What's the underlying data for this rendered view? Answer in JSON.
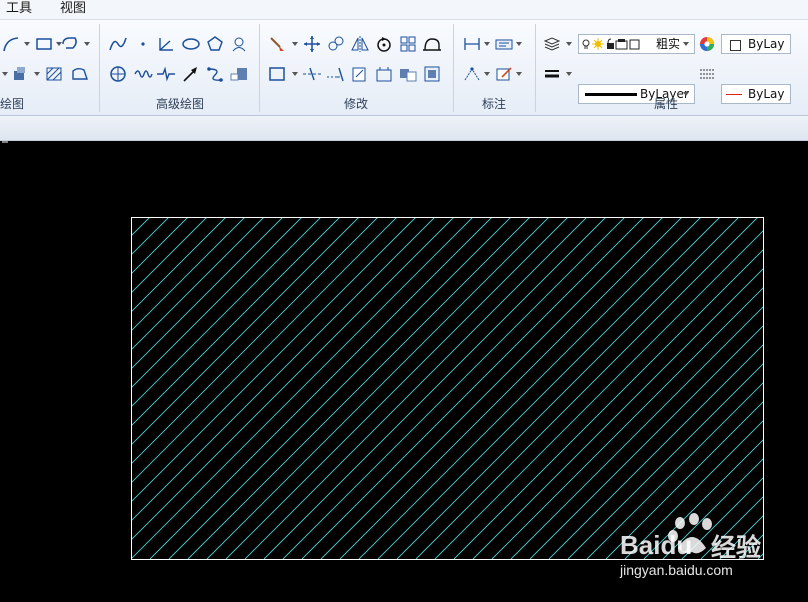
{
  "menubar": {
    "items": [
      {
        "label": "工具"
      },
      {
        "label": "视图"
      }
    ]
  },
  "ribbon": {
    "groups": [
      {
        "label": "绘图"
      },
      {
        "label": "高级绘图"
      },
      {
        "label": "修改"
      },
      {
        "label": "标注"
      },
      {
        "label": "属性"
      }
    ],
    "properties": {
      "layer_name": "粗实",
      "color_value": "ByLay",
      "lineweight_value": "ByLayer",
      "linetype_value": "ByLay",
      "accent_red": "#e02020"
    }
  },
  "drawing": {
    "hatch_color": "#4fd0d6",
    "border_color": "#ffffff",
    "background": "#000000"
  },
  "watermark": {
    "brand": "Baidu",
    "brand_cn": "经验",
    "url": "jingyan.baidu.com"
  }
}
